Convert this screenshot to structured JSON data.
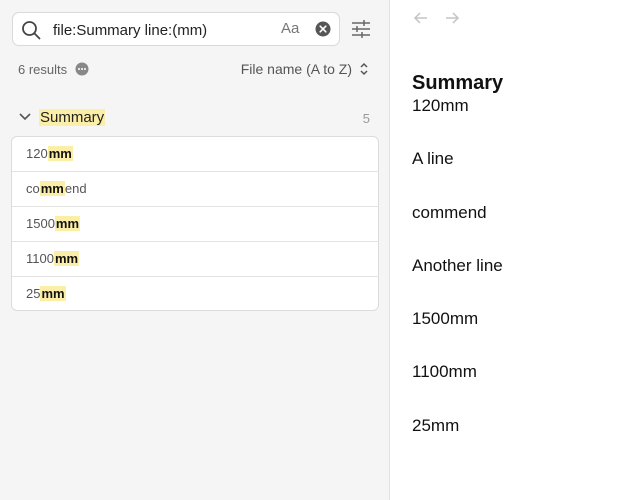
{
  "search": {
    "query": "file:Summary line:(mm)",
    "match_case_label": "Aa",
    "icons": {
      "search": "search-icon",
      "clear": "clear-circle-icon",
      "filter": "sliders-icon"
    }
  },
  "results_bar": {
    "count_label": "6 results",
    "sort_label": "File name (A to Z)",
    "icons": {
      "more": "more-dots-icon",
      "sort": "up-down-chevron-icon"
    }
  },
  "group": {
    "title": "Summary",
    "count": "5",
    "icon": "chevron-down-icon"
  },
  "results": [
    {
      "pre": "120",
      "match": "mm",
      "post": ""
    },
    {
      "pre": "co",
      "match": "mm",
      "post": "end"
    },
    {
      "pre": "1500",
      "match": "mm",
      "post": ""
    },
    {
      "pre": "1100",
      "match": "mm",
      "post": ""
    },
    {
      "pre": "25",
      "match": "mm",
      "post": ""
    }
  ],
  "nav": {
    "back_icon": "arrow-left-icon",
    "forward_icon": "arrow-right-icon"
  },
  "document": {
    "title": "Summary",
    "lines": [
      "120mm",
      "A line",
      "commend",
      "Another line",
      "1500mm",
      "1100mm",
      "25mm"
    ]
  },
  "colors": {
    "highlight": "#fbeea6",
    "sidebar_bg": "#f5f5f5",
    "border": "#dcdcdc"
  }
}
